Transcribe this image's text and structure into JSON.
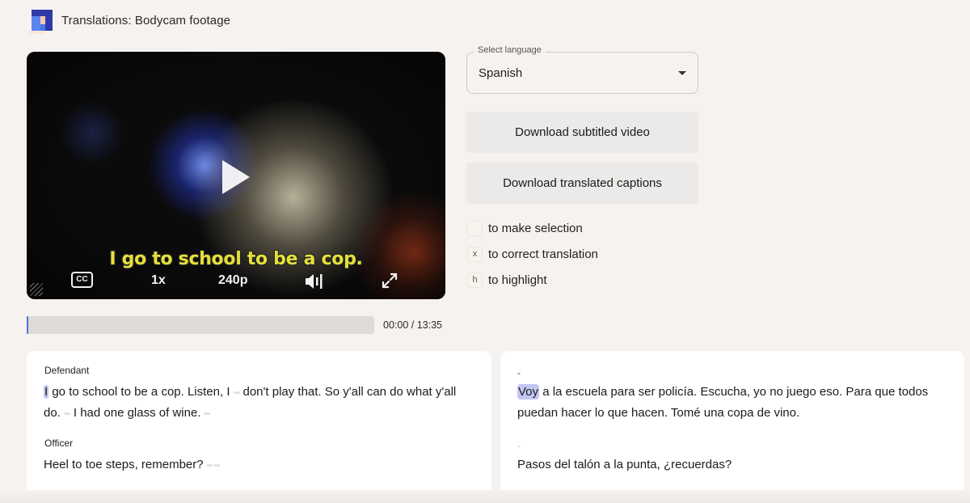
{
  "header": {
    "title": "Translations: Bodycam footage",
    "logo": "app-logo"
  },
  "video": {
    "subtitle": "I go to school to be a cop.",
    "controls": {
      "cc_label": "CC",
      "speed": "1x",
      "quality": "240p",
      "volume_icon": "volume-icon",
      "fullscreen_icon": "expand-icon",
      "play_icon": "play-icon"
    },
    "progress": {
      "played_fraction": 0.0,
      "time_label": "00:00 / 13:35"
    }
  },
  "language_select": {
    "label": "Select language",
    "value": "Spanish"
  },
  "buttons": {
    "download_video": "Download subtitled video",
    "download_captions": "Download translated captions"
  },
  "hints": [
    {
      "key": "",
      "text": "to make selection"
    },
    {
      "key": "x",
      "text": "to correct translation"
    },
    {
      "key": "h",
      "text": "to highlight"
    }
  ],
  "transcript": {
    "original": [
      {
        "speaker": "Defendant",
        "highlight": "I",
        "parts": [
          "go to school to be a cop. Listen, I",
          "don't play that. So y'all can do what y'all do.",
          "I had one glass of wine."
        ]
      },
      {
        "speaker": "Officer",
        "parts": [
          "Heel to toe steps, remember?"
        ]
      }
    ],
    "translated": [
      {
        "speaker": "-",
        "highlight": "Voy",
        "text": "a la escuela para ser policía. Escucha, yo no juego eso. Para que todos puedan hacer lo que hacen. Tomé una copa de vino."
      },
      {
        "speaker": "-",
        "text": "Pasos del talón a la punta, ¿recuerdas?"
      }
    ]
  }
}
